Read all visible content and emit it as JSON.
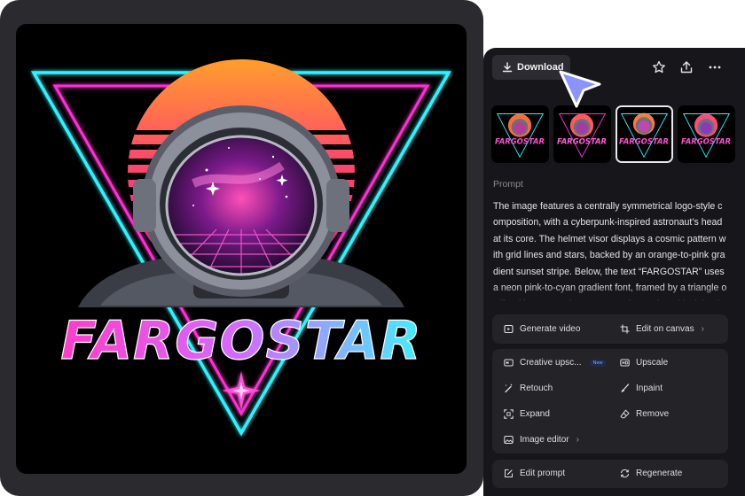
{
  "artwork": {
    "logo_text": "FARGOSTAR"
  },
  "toolbar": {
    "download_label": "Download",
    "icons": [
      "download-icon",
      "star-icon",
      "share-icon",
      "more-icon"
    ]
  },
  "thumbnails": [
    {
      "text": "FARGOSTAR",
      "selected": false
    },
    {
      "text": "FARGOSTAR",
      "selected": false
    },
    {
      "text": "FARGOSTAR",
      "selected": true
    },
    {
      "text": "FARGOSTAR",
      "selected": false
    }
  ],
  "prompt": {
    "label": "Prompt",
    "text": "The image features a centrally symmetrical logo-style composition, with a cyberpunk-inspired astronaut’s head at its core. The helmet visor displays a cosmic pattern with grid lines and stars, backed by an orange-to-pink gradient sunset stripe. Below, the text “FARGOSTAR” uses a neon pink-to-cyan gradient font, framed by a triangle outlined in cyan and magenta against a deep black backgr"
  },
  "actions": {
    "generate_video": "Generate video",
    "edit_on_canvas": "Edit on canvas",
    "creative_upscale": "Creative upsc...",
    "new_badge": "New",
    "upscale": "Upscale",
    "retouch": "Retouch",
    "inpaint": "Inpaint",
    "expand": "Expand",
    "remove": "Remove",
    "image_editor": "Image editor",
    "edit_prompt": "Edit prompt",
    "regenerate": "Regenerate"
  },
  "colors": {
    "panel_bg": "#17171b",
    "group_bg": "#232328",
    "pointer": "#8a93ff",
    "neon_cyan": "#2ff3ff",
    "neon_magenta": "#ff2fd6",
    "sunset_orange": "#ff9a2a"
  }
}
